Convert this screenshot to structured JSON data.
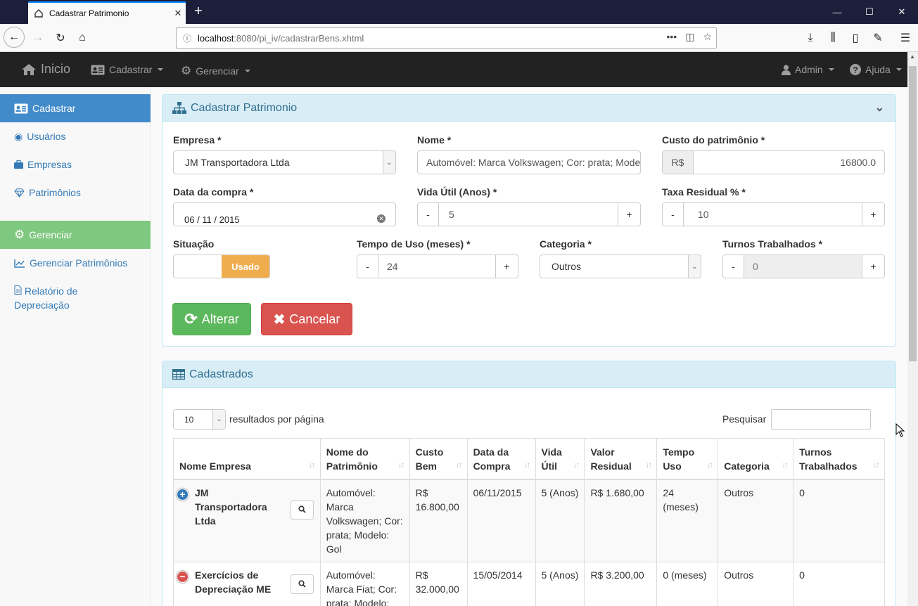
{
  "browser": {
    "tab_title": "Cadastrar Patrimonio",
    "url_host": "localhost",
    "url_path": ":8080/pi_iv/cadastrarBens.xhtml"
  },
  "appnav": {
    "brand": "Inicio",
    "cadastrar": "Cadastrar",
    "gerenciar": "Gerenciar",
    "admin": "Admin",
    "ajuda": "Ajuda"
  },
  "sidebar": {
    "cadastrar_header": "Cadastrar",
    "usuarios": "Usuários",
    "empresas": "Empresas",
    "patrimonios": "Patrimônios",
    "gerenciar_header": "Gerenciar",
    "gerenciar_patrimonios": "Gerenciar Patrimônios",
    "relatorio_line1": "Relatório de",
    "relatorio_line2": "Depreciação",
    "colors": {
      "cadastrar": "#428bca",
      "gerenciar": "#7fc87f"
    }
  },
  "form": {
    "title": "Cadastrar Patrimonio",
    "empresa_label": "Empresa *",
    "empresa_value": "JM Transportadora Ltda",
    "nome_label": "Nome *",
    "nome_value": "Automóvel: Marca Volkswagen; Cor: prata; Modelo: Gol",
    "custo_label": "Custo do patrimônio *",
    "custo_prefix": "R$",
    "custo_value": "16800.0",
    "data_label": "Data da compra *",
    "data_value": "06 / 11 / 2015",
    "vida_label": "Vida Útil (Anos) *",
    "vida_value": "5",
    "taxa_label": "Taxa Residual % *",
    "taxa_value": "10",
    "situacao_label": "Situação",
    "situacao_value": "Usado",
    "tempo_label": "Tempo de Uso (meses) *",
    "tempo_value": "24",
    "categoria_label": "Categoria *",
    "categoria_value": "Outros",
    "turnos_label": "Turnos Trabalhados *",
    "turnos_value": "0",
    "minus": "-",
    "plus": "+",
    "alterar": "Alterar",
    "cancelar": "Cancelar"
  },
  "list": {
    "title": "Cadastrados",
    "page_size": "10",
    "page_size_label": "resultados por página",
    "search_label": "Pesquisar",
    "search_value": "",
    "columns": [
      "Nome Empresa",
      "Nome do Patrimônio",
      "Custo Bem",
      "Data da Compra",
      "Vida Útil",
      "Valor Residual",
      "Tempo Uso",
      "Categoria",
      "Turnos Trabalhados"
    ],
    "rows": [
      {
        "empresa": "JM Transportadora Ltda",
        "patrimonio": "Automóvel: Marca Volkswagen; Cor: prata; Modelo: Gol",
        "custo": "R$ 16.800,00",
        "data": "06/11/2015",
        "vida": "5 (Anos)",
        "residual": "R$ 1.680,00",
        "tempo": "24 (meses)",
        "categoria": "Outros",
        "turnos": "0"
      },
      {
        "empresa": "Exercícios de Depreciação ME",
        "patrimonio": "Automóvel: Marca Fiat; Cor: prata; Modelo:",
        "custo": "R$ 32.000,00",
        "data": "15/05/2014",
        "vida": "5 (Anos)",
        "residual": "R$ 3.200,00",
        "tempo": "0 (meses)",
        "categoria": "Outros",
        "turnos": "0"
      }
    ]
  }
}
